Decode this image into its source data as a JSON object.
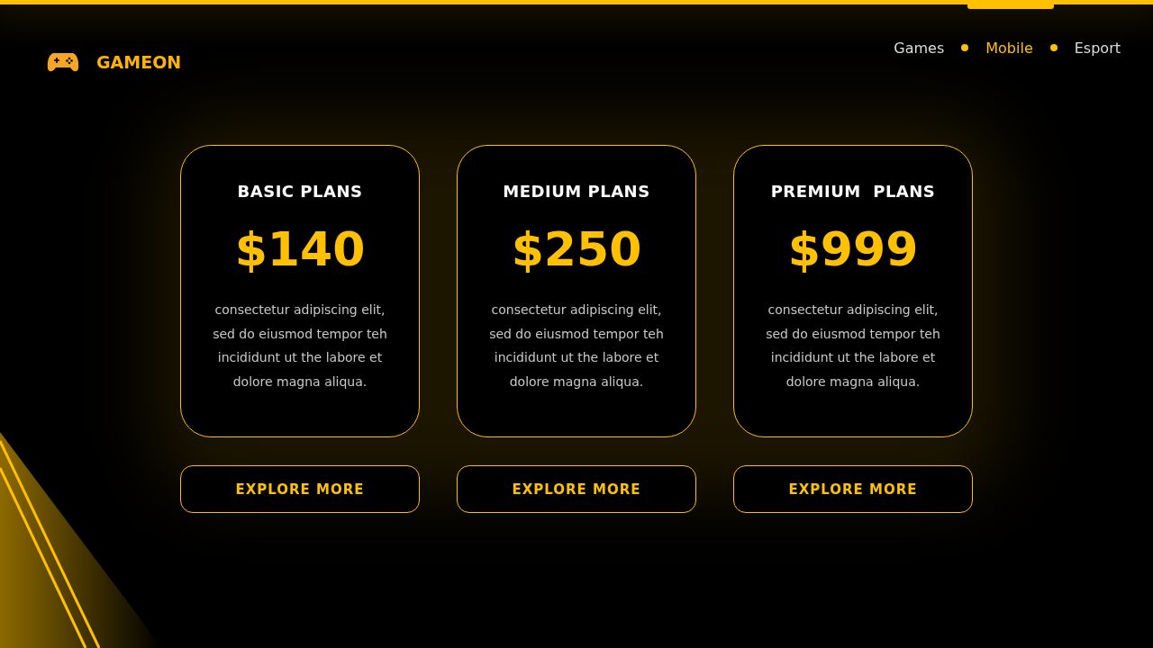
{
  "brand": {
    "name": "GAMEON"
  },
  "nav": [
    {
      "label": "Games",
      "selected": false
    },
    {
      "label": "Mobile",
      "selected": true
    },
    {
      "label": "Esport",
      "selected": false
    }
  ],
  "plans": [
    {
      "title": "BASIC PLANS",
      "price": "$140",
      "description": "consectetur adipiscing elit,\nsed do eiusmod tempor teh\nincididunt ut the labore et\ndolore magna aliqua.",
      "button": "EXPLORE MORE"
    },
    {
      "title": "MEDIUM PLANS",
      "price": "$250",
      "description": "consectetur adipiscing elit,\nsed do eiusmod tempor teh\nincididunt ut the labore et\ndolore magna aliqua.",
      "button": "EXPLORE MORE"
    },
    {
      "title": "PREMIUM  PLANS",
      "price": "$999",
      "description": "consectetur adipiscing elit,\nsed do eiusmod tempor teh\nincididunt ut the labore et\ndolore magna aliqua.",
      "button": "EXPLORE MORE"
    }
  ]
}
